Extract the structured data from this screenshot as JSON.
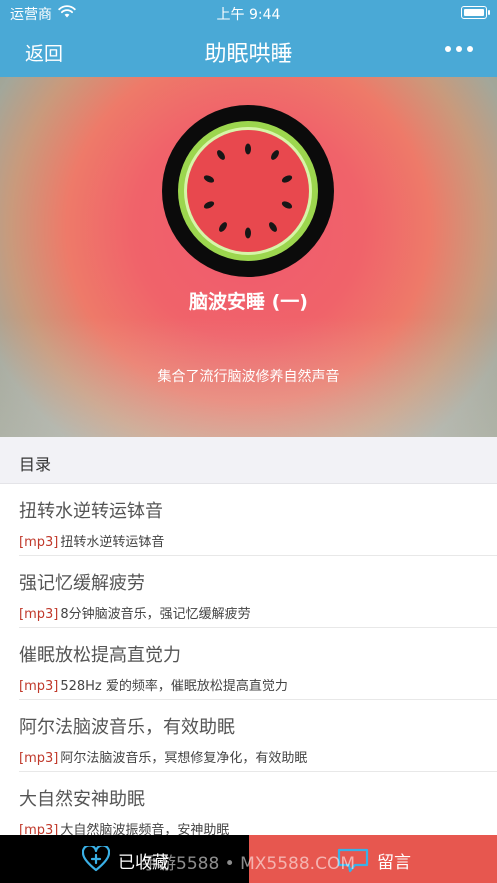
{
  "status_bar": {
    "carrier": "运营商",
    "time": "上午 9:44"
  },
  "nav": {
    "back_label": "返回",
    "title": "助眠哄睡",
    "more_icon": "more-dots-icon"
  },
  "hero": {
    "album_title": "脑波安睡 (一)",
    "album_desc": "集合了流行脑波修养自然声音",
    "cover_icon": "watermelon-icon",
    "colors": {
      "accent": "#4aa9d6",
      "hero_center": "#ef5a6e"
    }
  },
  "catalog": {
    "header": "目录",
    "tracks": [
      {
        "title": "扭转水逆转运钵音",
        "tag": "[mp3]",
        "desc": "扭转水逆转运钵音"
      },
      {
        "title": "强记忆缓解疲劳",
        "tag": "[mp3]",
        "desc": "8分钟脑波音乐，强记忆缓解疲劳"
      },
      {
        "title": "催眠放松提高直觉力",
        "tag": "[mp3]",
        "desc": "528Hz 爱的频率，催眠放松提高直觉力"
      },
      {
        "title": "阿尔法脑波音乐，有效助眠",
        "tag": "[mp3]",
        "desc": "阿尔法脑波音乐，冥想修复净化，有效助眠"
      },
      {
        "title": "大自然安神助眠",
        "tag": "[mp3]",
        "desc": "大自然脑波振频音，安神助眠"
      }
    ]
  },
  "bottom": {
    "favorite_label": "已收藏",
    "comment_label": "留言",
    "favorite_color": "#000000",
    "comment_color": "#e7574f"
  },
  "watermark": "手游5588 • MX5588.COM"
}
